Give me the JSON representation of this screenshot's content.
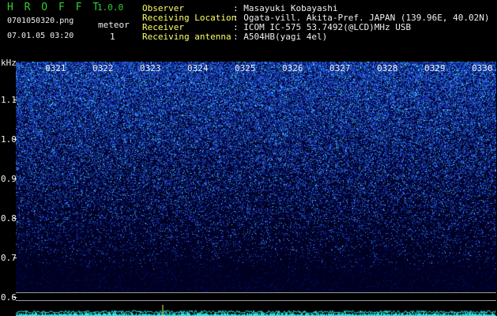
{
  "header": {
    "app_title": "H R O F F T",
    "version": "1.0.0",
    "filename": "0701050320.png",
    "datetime": "07.01.05 03:20",
    "count_label": "meteor",
    "count_value": "1",
    "info": [
      {
        "label": "Observer",
        "value": ": Masayuki Kobayashi"
      },
      {
        "label": "Receiving Location",
        "value": ": Ogata-vill. Akita-Pref. JAPAN (139.96E, 40.02N)"
      },
      {
        "label": "Receiver",
        "value": ": ICOM IC-575 53.7492(@LCD)MHz USB"
      },
      {
        "label": "Receiving antenna",
        "value": ": A504HB(yagi 4el)"
      }
    ]
  },
  "axis": {
    "unit": "kHz",
    "y_ticks": [
      "1.1",
      "1.0",
      "0.9",
      "0.8",
      "0.7",
      "0.6"
    ],
    "time_labels": [
      "0321",
      "0322",
      "0323",
      "0324",
      "0325",
      "0326",
      "0327",
      "0328",
      "0329",
      "0330"
    ]
  },
  "colors": {
    "background": "#000000",
    "title_green": "#33cc33",
    "label_yellow": "#ffff66",
    "noise_blue": "#2a4dd8",
    "noise_cyan": "#33ffff",
    "trace_cyan": "#33e6e6"
  }
}
